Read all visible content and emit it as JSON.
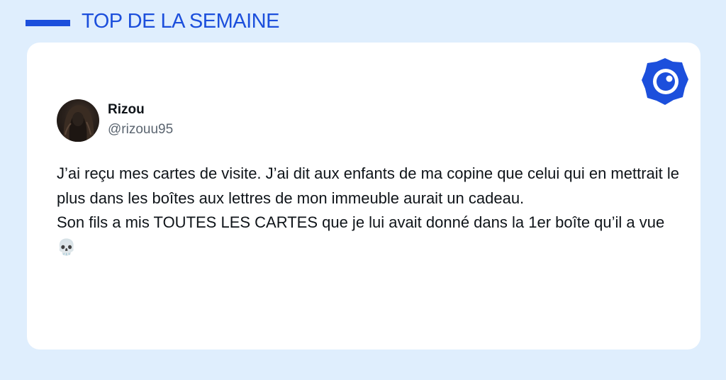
{
  "header": {
    "title": "TOP DE LA SEMAINE",
    "accent_color": "#1c4fdc"
  },
  "card": {
    "logo_icon": "brand-badge-icon",
    "author": {
      "name": "Rizou",
      "handle": "@rizouu95"
    },
    "tweet_text": "J’ai reçu mes cartes de visite. J’ai dit aux enfants de ma copine que celui qui en mettrait le plus dans les boîtes aux lettres de mon immeuble aurait un cadeau.\nSon fils a mis TOUTES LES CARTES que je lui avait donné dans la 1er boîte qu’il a vue 💀"
  }
}
